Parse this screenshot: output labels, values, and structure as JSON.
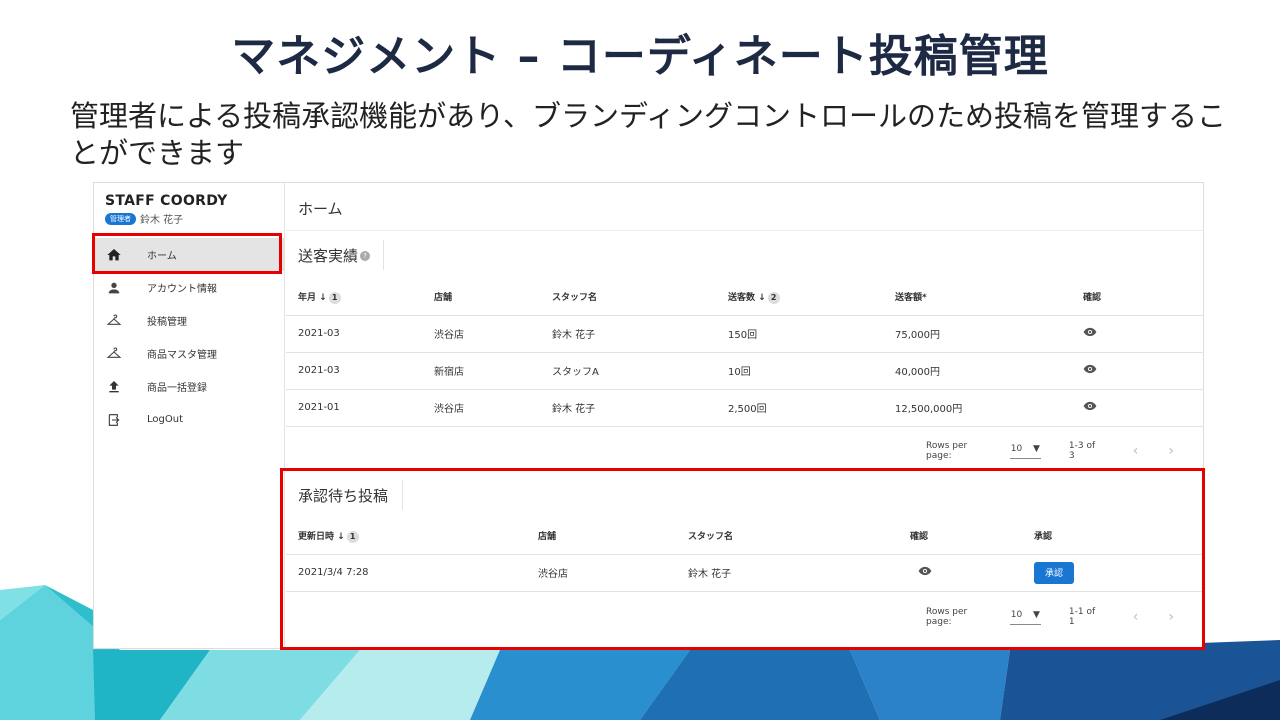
{
  "slide": {
    "title": "マネジメント – コーディネート投稿管理",
    "subtitle": "管理者による投稿承認機能があり、ブランディングコントロールのため投稿を管理することができます"
  },
  "brand": "STAFF COORDY",
  "user": {
    "role": "管理者",
    "name": "鈴木 花子"
  },
  "nav": [
    {
      "label": "ホーム",
      "icon": "home-icon"
    },
    {
      "label": "アカウント情報",
      "icon": "person-icon"
    },
    {
      "label": "投稿管理",
      "icon": "hanger-icon"
    },
    {
      "label": "商品マスタ管理",
      "icon": "hanger-icon"
    },
    {
      "label": "商品一括登録",
      "icon": "upload-icon"
    },
    {
      "label": "LogOut",
      "icon": "logout-icon"
    }
  ],
  "main": {
    "header": "ホーム"
  },
  "sales": {
    "title": "送客実績",
    "columns": {
      "month": "年月",
      "store": "店舗",
      "staff": "スタッフ名",
      "count": "送客数",
      "amount": "送客額*",
      "check": "確認"
    },
    "sort": {
      "month": "1",
      "count": "2"
    },
    "rows": [
      {
        "month": "2021-03",
        "store": "渋谷店",
        "staff": "鈴木 花子",
        "count": "150回",
        "amount": "75,000円"
      },
      {
        "month": "2021-03",
        "store": "新宿店",
        "staff": "スタッフA",
        "count": "10回",
        "amount": "40,000円"
      },
      {
        "month": "2021-01",
        "store": "渋谷店",
        "staff": "鈴木 花子",
        "count": "2,500回",
        "amount": "12,500,000円"
      }
    ],
    "pager": {
      "label": "Rows per page:",
      "value": "10",
      "range": "1-3 of 3"
    }
  },
  "pending": {
    "title": "承認待ち投稿",
    "columns": {
      "updated": "更新日時",
      "store": "店舗",
      "staff": "スタッフ名",
      "check": "確認",
      "approve": "承認"
    },
    "sort": {
      "updated": "1"
    },
    "rows": [
      {
        "updated": "2021/3/4 7:28",
        "store": "渋谷店",
        "staff": "鈴木 花子",
        "action": "承認"
      }
    ],
    "pager": {
      "label": "Rows per page:",
      "value": "10",
      "range": "1-1 of 1"
    }
  },
  "colors": {
    "accent": "#1976d2",
    "highlight": "#e60000",
    "title": "#1e2a44"
  }
}
